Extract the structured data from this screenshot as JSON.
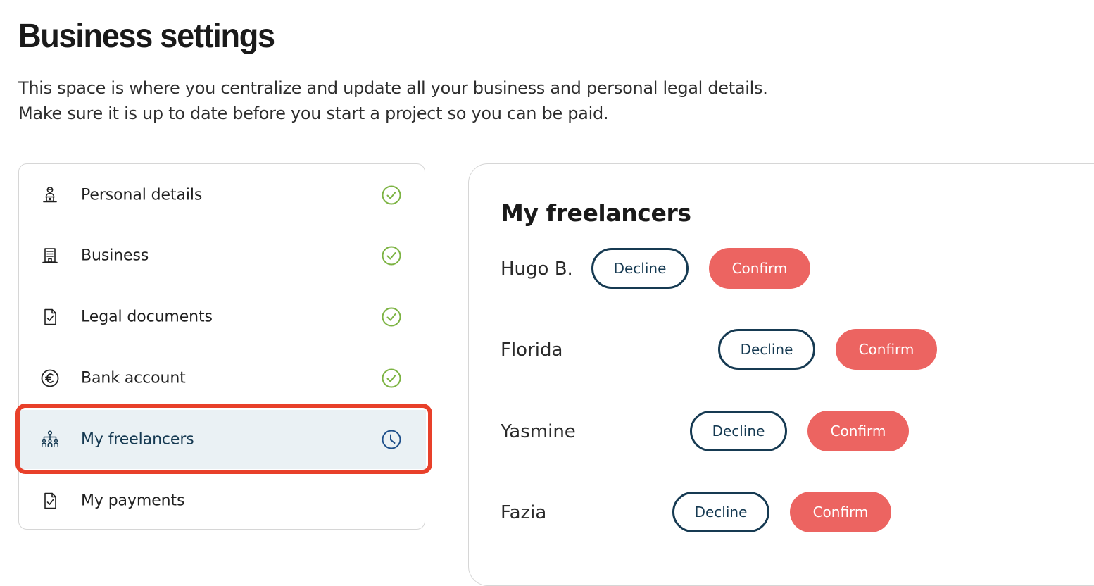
{
  "page": {
    "title": "Business settings",
    "description_line1": "This space is where you centralize and update all your business and personal legal details.",
    "description_line2": "Make sure it is up to date before you start a project so you can be paid."
  },
  "sidebar": {
    "items": [
      {
        "label": "Personal details",
        "icon": "person-desk-icon",
        "status": "complete"
      },
      {
        "label": "Business",
        "icon": "building-icon",
        "status": "complete"
      },
      {
        "label": "Legal documents",
        "icon": "document-check-icon",
        "status": "complete"
      },
      {
        "label": "Bank account",
        "icon": "euro-icon",
        "status": "complete"
      },
      {
        "label": "My freelancers",
        "icon": "team-icon",
        "status": "pending",
        "active": true
      },
      {
        "label": "My payments",
        "icon": "document-check-icon",
        "status": "none"
      }
    ]
  },
  "freelancers": {
    "title": "My freelancers",
    "decline_label": "Decline",
    "confirm_label": "Confirm",
    "list": [
      {
        "name": "Hugo B."
      },
      {
        "name": "Florida"
      },
      {
        "name": "Yasmine"
      },
      {
        "name": "Fazia"
      }
    ]
  },
  "colors": {
    "complete": "#7cb342",
    "pending": "#1d4f8a",
    "decline_border": "#163a52",
    "confirm_bg": "#ec6461",
    "active_bg": "#eaf1f4",
    "highlight": "#e8402a"
  }
}
